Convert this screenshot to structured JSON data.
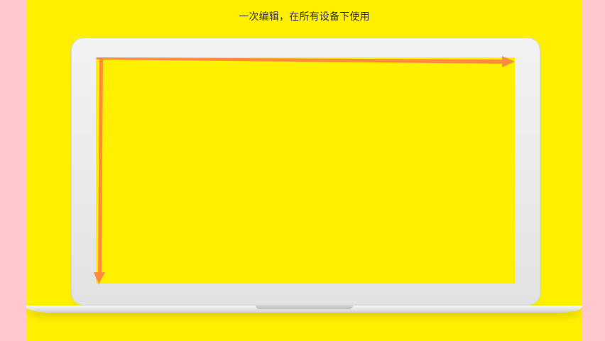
{
  "caption": "一次编辑，在所有设备下使用",
  "colors": {
    "page_side": "#ffc8cc",
    "stage_background": "#fff000",
    "arrow": "#ff8c3a",
    "laptop_frame": "#e9e9e9"
  },
  "icons": {
    "horizontal_arrow": "arrow-right-icon",
    "vertical_arrow": "arrow-down-icon"
  }
}
